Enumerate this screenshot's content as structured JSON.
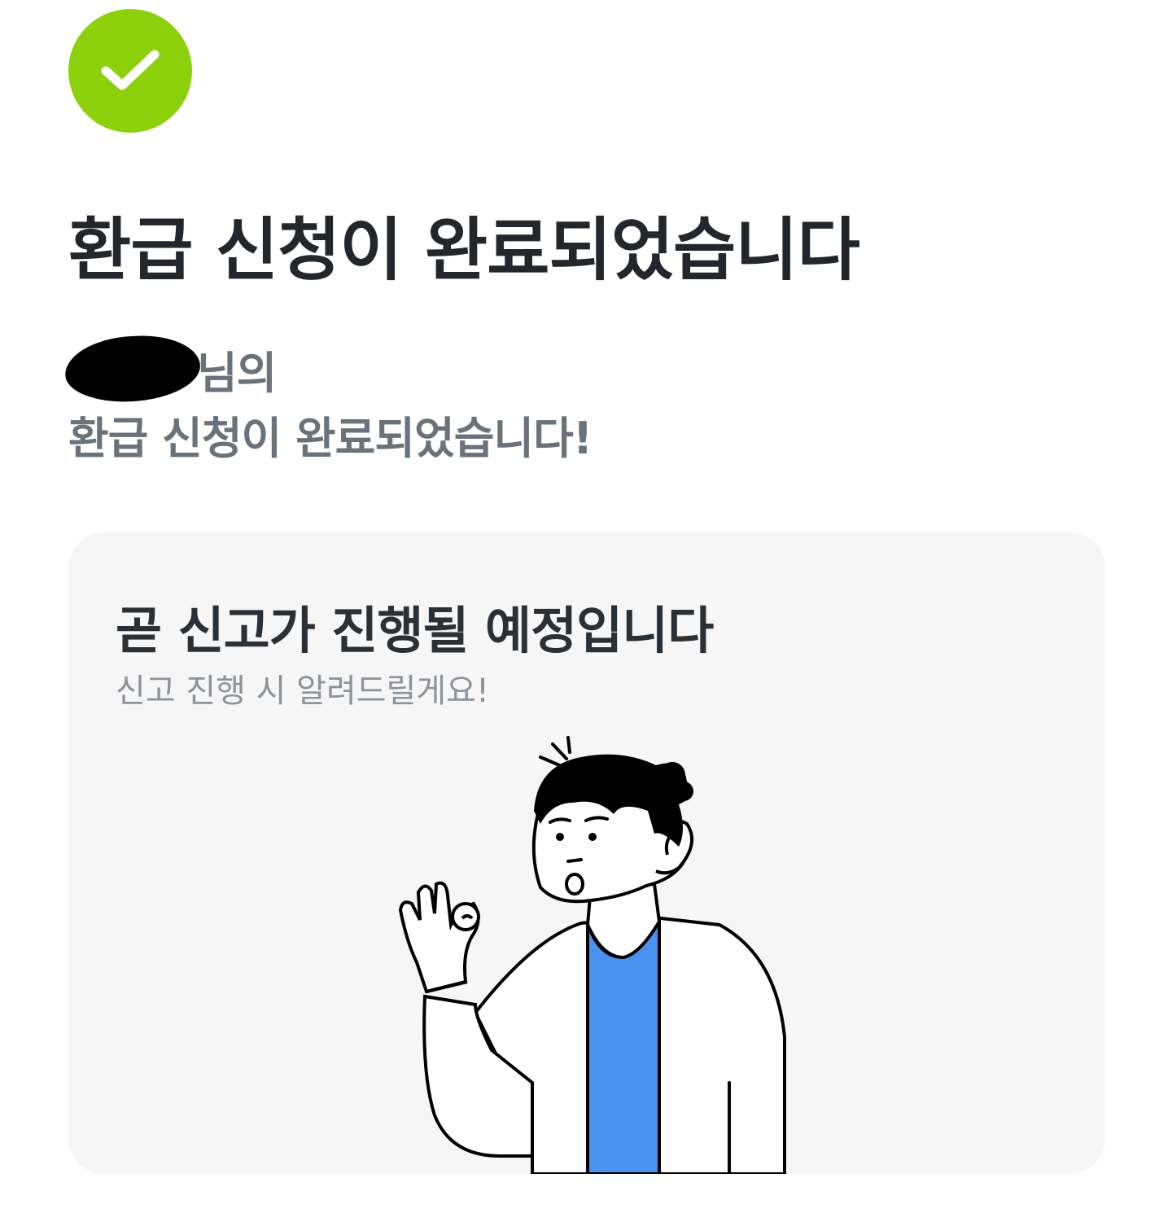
{
  "status": {
    "icon": "check-circle-icon",
    "color": "#8dd00c"
  },
  "header": {
    "title": "환급 신청이 완료되었습니다"
  },
  "message": {
    "user_suffix": "님의",
    "line2": "환급 신청이 완료되었습니다!"
  },
  "card": {
    "title": "곧 신고가 진행될 예정입니다",
    "subtitle": "신고 진행 시 알려드릴게요!",
    "illustration": "person-ok-gesture-illustration",
    "shirt_color": "#4a92ef"
  }
}
